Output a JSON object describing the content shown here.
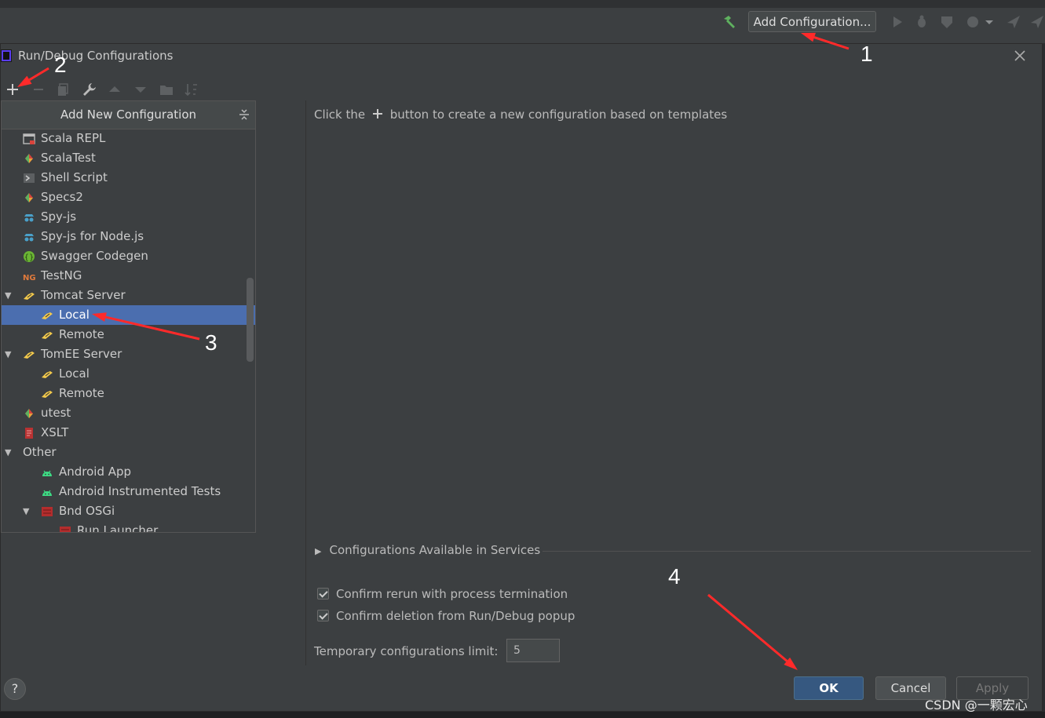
{
  "ide_toolbar": {
    "add_configuration_label": "Add Configuration..."
  },
  "dialog": {
    "title": "Run/Debug Configurations",
    "popup": {
      "header": "Add New Configuration",
      "items": [
        {
          "label": "Scala REPL",
          "icon": "scala-repl-icon"
        },
        {
          "label": "ScalaTest",
          "icon": "scala-icon"
        },
        {
          "label": "Shell Script",
          "icon": "shell-icon"
        },
        {
          "label": "Specs2",
          "icon": "scala-icon"
        },
        {
          "label": "Spy-js",
          "icon": "spy-icon"
        },
        {
          "label": "Spy-js for Node.js",
          "icon": "spy-icon"
        },
        {
          "label": "Swagger Codegen",
          "icon": "swagger-icon"
        },
        {
          "label": "TestNG",
          "icon": "testng-icon"
        },
        {
          "label": "Tomcat Server",
          "icon": "tomcat-icon",
          "expanded": true
        },
        {
          "label": "Local",
          "icon": "tomcat-icon",
          "selected": true
        },
        {
          "label": "Remote",
          "icon": "tomcat-icon"
        },
        {
          "label": "TomEE Server",
          "icon": "tomcat-icon",
          "expanded": true
        },
        {
          "label": "Local",
          "icon": "tomcat-icon"
        },
        {
          "label": "Remote",
          "icon": "tomcat-icon"
        },
        {
          "label": "utest",
          "icon": "scala-icon"
        },
        {
          "label": "XSLT",
          "icon": "xslt-icon"
        },
        {
          "label": "Other",
          "expanded": true
        },
        {
          "label": "Android App",
          "icon": "android-icon"
        },
        {
          "label": "Android Instrumented Tests",
          "icon": "android-icon"
        },
        {
          "label": "Bnd OSGi",
          "icon": "bnd-icon",
          "expanded": true
        },
        {
          "label": "Run Launcher",
          "icon": "bnd-icon"
        }
      ]
    },
    "hint_before": "Click the",
    "hint_after": "button to create a new configuration based on templates",
    "services_label": "Configurations Available in Services",
    "confirm_rerun_label": "Confirm rerun with process termination",
    "confirm_delete_label": "Confirm deletion from Run/Debug popup",
    "temp_limit_label": "Temporary configurations limit:",
    "temp_limit_value": "5",
    "buttons": {
      "help": "?",
      "ok": "OK",
      "cancel": "Cancel",
      "apply": "Apply"
    }
  },
  "annotations": {
    "n1": "1",
    "n2": "2",
    "n3": "3",
    "n4": "4",
    "arrow_color": "#ff2a2a"
  },
  "watermark": "CSDN @一颗宏心"
}
